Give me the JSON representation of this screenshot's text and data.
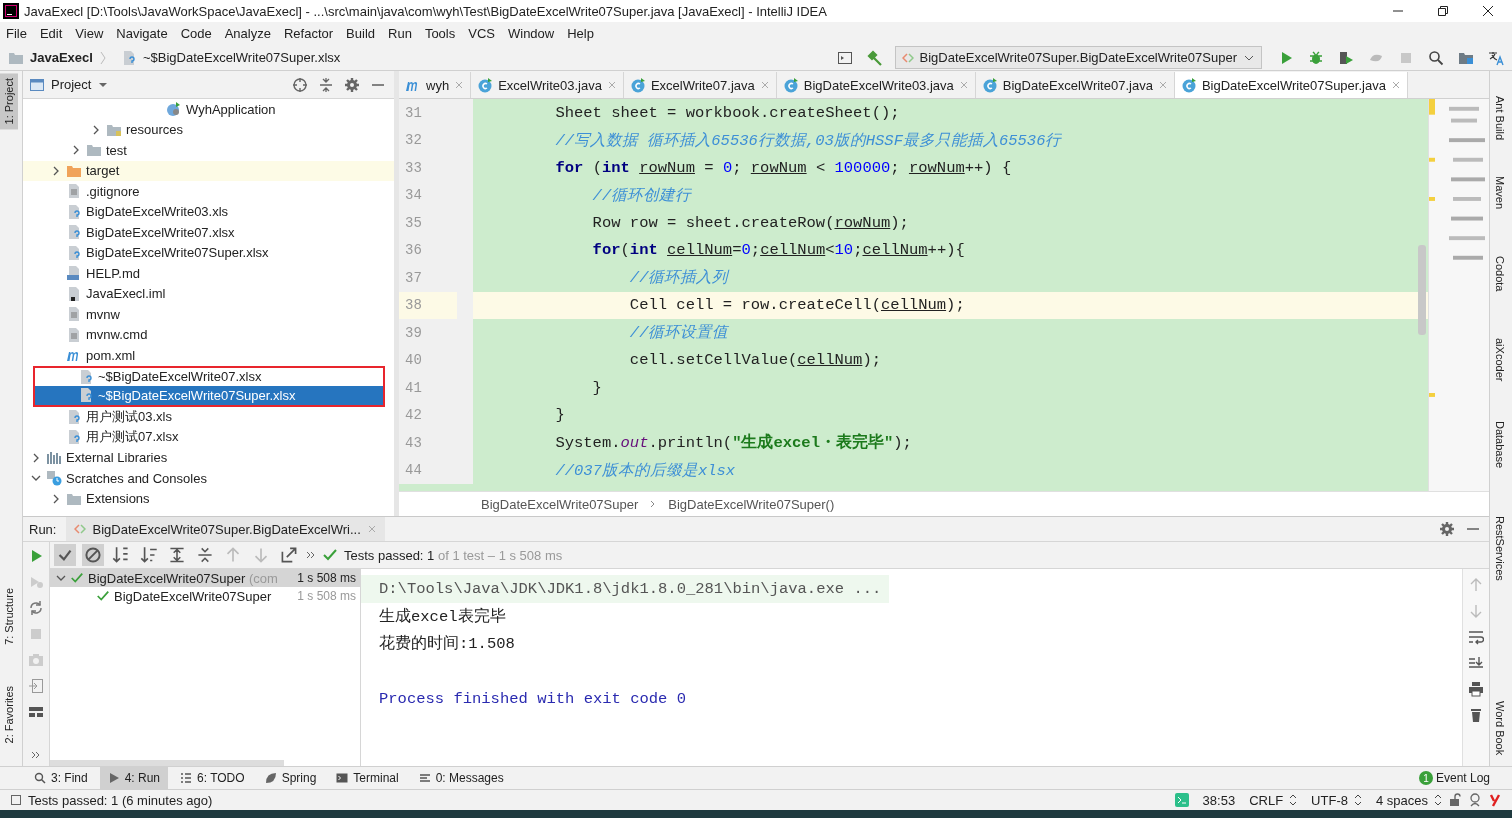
{
  "window": {
    "title": "JavaExecl [D:\\Tools\\JavaWorkSpace\\JavaExecl] - ...\\src\\main\\java\\com\\wyh\\Test\\BigDateExcelWrite07Super.java [JavaExecl] - IntelliJ IDEA"
  },
  "menu": [
    "File",
    "Edit",
    "View",
    "Navigate",
    "Code",
    "Analyze",
    "Refactor",
    "Build",
    "Run",
    "Tools",
    "VCS",
    "Window",
    "Help"
  ],
  "navbar": {
    "project": "JavaExecl",
    "file": "~$BigDateExcelWrite07Super.xlsx",
    "run_config": "BigDateExcelWrite07Super.BigDateExcelWrite07Super"
  },
  "left_strip": [
    {
      "label": "1: Project",
      "selected": true
    },
    {
      "label": "7: Structure",
      "selected": false
    },
    {
      "label": "2: Favorites",
      "selected": false
    }
  ],
  "right_strip": [
    "Ant Build",
    "Maven",
    "Codota",
    "aiXcoder",
    "Database",
    "RestServices",
    "Word Book"
  ],
  "project": {
    "title": "Project",
    "tree": [
      {
        "children": [
          {
            "children": [
              {
                "children": [
                  {
                    "children": [
                      {
                        "children": [
                          {
                            "children": [
                              {
                                "label": "WyhApplication",
                                "kind": "app",
                                "selected": false
                              }
                            ]
                          }
                        ]
                      }
                    ]
                  },
                  {
                    "label": "resources",
                    "kind": "folder-resources",
                    "expanded": false,
                    "selected": false
                  }
                ]
              },
              {
                "label": "test",
                "kind": "folder",
                "expanded": false,
                "selected": false
              }
            ]
          },
          {
            "label": "target",
            "kind": "folder-orange",
            "expanded": false,
            "excluded": true,
            "selected": false
          },
          {
            "label": ".gitignore",
            "kind": "file-text",
            "selected": false
          },
          {
            "label": "BigDateExcelWrite03.xls",
            "kind": "file-unknown",
            "selected": false
          },
          {
            "label": "BigDateExcelWrite07.xlsx",
            "kind": "file-unknown",
            "selected": false
          },
          {
            "label": "BigDateExcelWrite07Super.xlsx",
            "kind": "file-unknown",
            "selected": false
          },
          {
            "label": "HELP.md",
            "kind": "file-md",
            "selected": false
          },
          {
            "label": "JavaExecl.iml",
            "kind": "file-iml",
            "selected": false
          },
          {
            "label": "mvnw",
            "kind": "file-text",
            "selected": false
          },
          {
            "label": "mvnw.cmd",
            "kind": "file-text",
            "selected": false
          },
          {
            "label": "pom.xml",
            "kind": "maven",
            "selected": false
          },
          {
            "label": "~$BigDateExcelWrite07.xlsx",
            "kind": "file-unknown",
            "outlined": true,
            "selected": false
          },
          {
            "label": "~$BigDateExcelWrite07Super.xlsx",
            "kind": "file-unknown",
            "outlined": true,
            "selected": true
          },
          {
            "label": "用户测试03.xls",
            "kind": "file-unknown",
            "selected": false
          },
          {
            "label": "用户测试07.xlsx",
            "kind": "file-unknown",
            "selected": false
          }
        ]
      },
      {
        "label": "External Libraries",
        "kind": "library",
        "expanded": false,
        "selected": false
      },
      {
        "label": "Scratches and Consoles",
        "kind": "scratch",
        "expanded": true,
        "selected": false,
        "children": [
          {
            "label": "Extensions",
            "kind": "folder",
            "expanded": false,
            "selected": false
          }
        ]
      }
    ]
  },
  "editor": {
    "tabs": [
      {
        "label": "wyh",
        "kind": "maven",
        "selected": false
      },
      {
        "label": "ExcelWrite03.java",
        "kind": "class",
        "selected": false
      },
      {
        "label": "ExcelWrite07.java",
        "kind": "class",
        "selected": false
      },
      {
        "label": "BigDateExcelWrite03.java",
        "kind": "class",
        "selected": false
      },
      {
        "label": "BigDateExcelWrite07.java",
        "kind": "class",
        "selected": false
      },
      {
        "label": "BigDateExcelWrite07Super.java",
        "kind": "class",
        "selected": true
      }
    ],
    "lines": [
      {
        "number": "31",
        "current": false,
        "tokens": [
          {
            "text": "        Sheet sheet = workbook.createSheet();",
            "kind": "plain"
          }
        ]
      },
      {
        "number": "32",
        "current": false,
        "tokens": [
          {
            "text": "        //写入数据 循环插入65536行数据,03版的HSSF最多只能插入65536行",
            "kind": "comment"
          }
        ]
      },
      {
        "number": "33",
        "current": false,
        "tokens": [
          {
            "text": "        for",
            "kind": "keyword"
          },
          {
            "text": " (",
            "kind": "plain"
          },
          {
            "text": "int ",
            "kind": "keyword"
          },
          {
            "text": "rowNum",
            "kind": "variable"
          },
          {
            "text": " = ",
            "kind": "plain"
          },
          {
            "text": "0",
            "kind": "number"
          },
          {
            "text": "; ",
            "kind": "plain"
          },
          {
            "text": "rowNum",
            "kind": "variable"
          },
          {
            "text": " < ",
            "kind": "plain"
          },
          {
            "text": "100000",
            "kind": "number"
          },
          {
            "text": "; ",
            "kind": "plain"
          },
          {
            "text": "rowNum",
            "kind": "variable"
          },
          {
            "text": "++) {",
            "kind": "plain"
          }
        ]
      },
      {
        "number": "34",
        "current": false,
        "tokens": [
          {
            "text": "            //循环创建行",
            "kind": "comment"
          }
        ]
      },
      {
        "number": "35",
        "current": false,
        "tokens": [
          {
            "text": "            Row row = sheet.createRow(",
            "kind": "plain"
          },
          {
            "text": "rowNum",
            "kind": "variable"
          },
          {
            "text": ");",
            "kind": "plain"
          }
        ]
      },
      {
        "number": "36",
        "current": false,
        "tokens": [
          {
            "text": "            for",
            "kind": "keyword"
          },
          {
            "text": "(",
            "kind": "plain"
          },
          {
            "text": "int ",
            "kind": "keyword"
          },
          {
            "text": "cellNum",
            "kind": "variable"
          },
          {
            "text": "=",
            "kind": "plain"
          },
          {
            "text": "0",
            "kind": "number"
          },
          {
            "text": ";",
            "kind": "plain"
          },
          {
            "text": "cellNum",
            "kind": "variable"
          },
          {
            "text": "<",
            "kind": "plain"
          },
          {
            "text": "10",
            "kind": "number"
          },
          {
            "text": ";",
            "kind": "plain"
          },
          {
            "text": "cellNum",
            "kind": "variable"
          },
          {
            "text": "++){",
            "kind": "plain"
          }
        ]
      },
      {
        "number": "37",
        "current": false,
        "tokens": [
          {
            "text": "                //循环插入列",
            "kind": "comment"
          }
        ]
      },
      {
        "number": "38",
        "current": true,
        "tokens": [
          {
            "text": "                Cell cell = row.createCell(",
            "kind": "plain"
          },
          {
            "text": "cellNum",
            "kind": "variable"
          },
          {
            "text": ");",
            "kind": "plain"
          }
        ]
      },
      {
        "number": "39",
        "current": false,
        "tokens": [
          {
            "text": "                //循环设置值",
            "kind": "comment"
          }
        ]
      },
      {
        "number": "40",
        "current": false,
        "tokens": [
          {
            "text": "                cell.setCellValue(",
            "kind": "plain"
          },
          {
            "text": "cellNum",
            "kind": "variable"
          },
          {
            "text": ");",
            "kind": "plain"
          }
        ]
      },
      {
        "number": "41",
        "current": false,
        "tokens": [
          {
            "text": "            }",
            "kind": "plain"
          }
        ]
      },
      {
        "number": "42",
        "current": false,
        "tokens": [
          {
            "text": "        }",
            "kind": "plain"
          }
        ]
      },
      {
        "number": "43",
        "current": false,
        "tokens": [
          {
            "text": "        System.",
            "kind": "plain"
          },
          {
            "text": "out",
            "kind": "static"
          },
          {
            "text": ".println(",
            "kind": "plain"
          },
          {
            "text": "\"生成excel・表完毕\"",
            "kind": "string"
          },
          {
            "text": ");",
            "kind": "plain"
          }
        ]
      },
      {
        "number": "44",
        "current": false,
        "tokens": [
          {
            "text": "        //037版本的后缀是xlsx",
            "kind": "comment"
          }
        ]
      }
    ],
    "breadcrumbs": [
      "BigDateExcelWrite07Super",
      "BigDateExcelWrite07Super()"
    ]
  },
  "run": {
    "label": "Run:",
    "tab": "BigDateExcelWrite07Super.BigDateExcelWri...",
    "summary": "Tests passed: 1",
    "summary_detail": "of 1 test – 1 s 508 ms",
    "tests": [
      {
        "name": "BigDateExcelWrite07Super",
        "detail": "(com",
        "time": "1 s 508 ms",
        "passed": true,
        "expanded": true,
        "selected": true,
        "children": [
          {
            "name": "BigDateExcelWrite07Super",
            "time": "1 s 508 ms",
            "passed": true,
            "selected": false
          }
        ]
      }
    ],
    "console": [
      {
        "text": "D:\\Tools\\Java\\JDK\\JDK1.8\\jdk1.8.0_281\\bin\\java.exe ...",
        "kind": "command"
      },
      {
        "text": "生成excel表完毕",
        "kind": "output"
      },
      {
        "text": "花费的时间:1.508",
        "kind": "output"
      },
      {
        "kind": "blank"
      },
      {
        "text": "Process finished with exit code 0",
        "kind": "exit"
      }
    ]
  },
  "tool_tabs": [
    {
      "label": "3: Find",
      "kind": "find",
      "selected": false
    },
    {
      "label": "4: Run",
      "kind": "run",
      "selected": true
    },
    {
      "label": "6: TODO",
      "kind": "todo",
      "selected": false
    },
    {
      "label": "Spring",
      "kind": "spring",
      "selected": false
    },
    {
      "label": "Terminal",
      "kind": "terminal",
      "selected": false
    },
    {
      "label": "0: Messages",
      "kind": "messages",
      "selected": false
    }
  ],
  "event_log": {
    "label": "Event Log",
    "badge": "1"
  },
  "status_bar": {
    "message": "Tests passed: 1 (6 minutes ago)",
    "position": "38:53",
    "line_separator": "CRLF",
    "encoding": "UTF-8",
    "indent": "4 spaces"
  }
}
